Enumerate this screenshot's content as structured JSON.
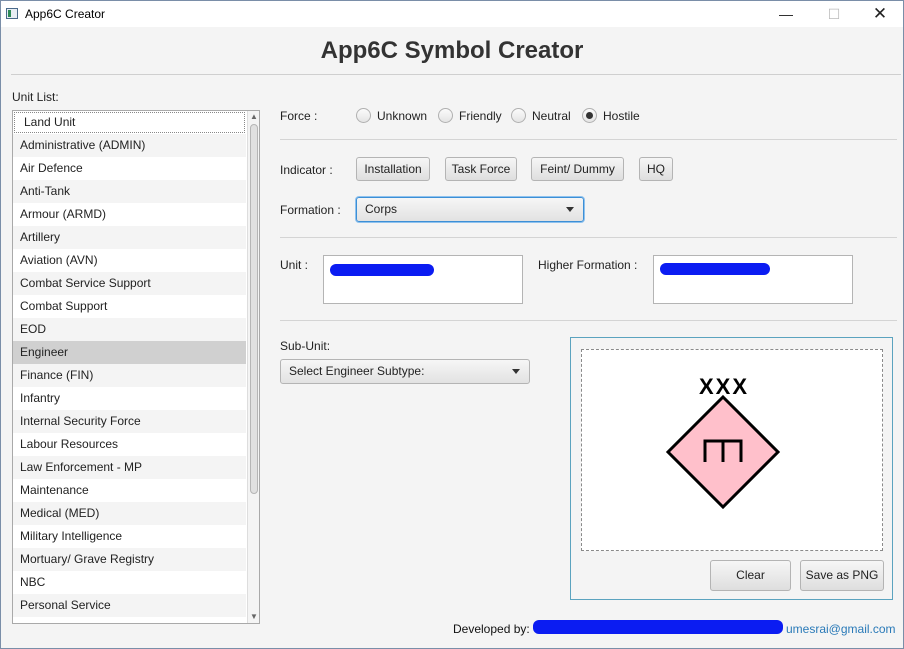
{
  "window": {
    "title": "App6C Creator",
    "minimize": "—",
    "maximize": "☐",
    "close": "✕"
  },
  "header": {
    "title": "App6C Symbol Creator"
  },
  "unit_list": {
    "label": "Unit List:",
    "selected": "Engineer",
    "items": [
      "Land Unit",
      "Administrative (ADMIN)",
      "Air Defence",
      "Anti-Tank",
      "Armour (ARMD)",
      "Artillery",
      "Aviation (AVN)",
      "Combat Service Support",
      "Combat Support",
      "EOD",
      "Engineer",
      "Finance (FIN)",
      "Infantry",
      "Internal Security Force",
      "Labour Resources",
      "Law Enforcement - MP",
      "Maintenance",
      "Medical (MED)",
      "Military Intelligence",
      "Mortuary/ Grave Registry",
      "NBC",
      "Personal Service"
    ]
  },
  "force": {
    "label": "Force :",
    "options": [
      "Unknown",
      "Friendly",
      "Neutral",
      "Hostile"
    ],
    "selected": "Hostile"
  },
  "indicator": {
    "label": "Indicator :",
    "buttons": [
      "Installation",
      "Task Force",
      "Feint/ Dummy",
      "HQ"
    ]
  },
  "formation": {
    "label": "Formation :",
    "value": "Corps"
  },
  "unit": {
    "label": "Unit :"
  },
  "higher_formation": {
    "label": "Higher Formation :"
  },
  "sub_unit": {
    "label": "Sub-Unit:",
    "value": "Select Engineer Subtype:"
  },
  "preview": {
    "echelon": "XXX",
    "frame_fill": "#ffc0cb",
    "frame_stroke": "#000000",
    "icon": "engineer-symbol",
    "clear_label": "Clear",
    "save_label": "Save as PNG"
  },
  "footer": {
    "developed_by": "Developed by:",
    "email": "umesrai@gmail.com"
  },
  "colors": {
    "accent": "#3c8fd6",
    "redaction": "#0b1cf2",
    "selection": "#d0d0d0",
    "hostile_fill": "#ffc0cb"
  }
}
